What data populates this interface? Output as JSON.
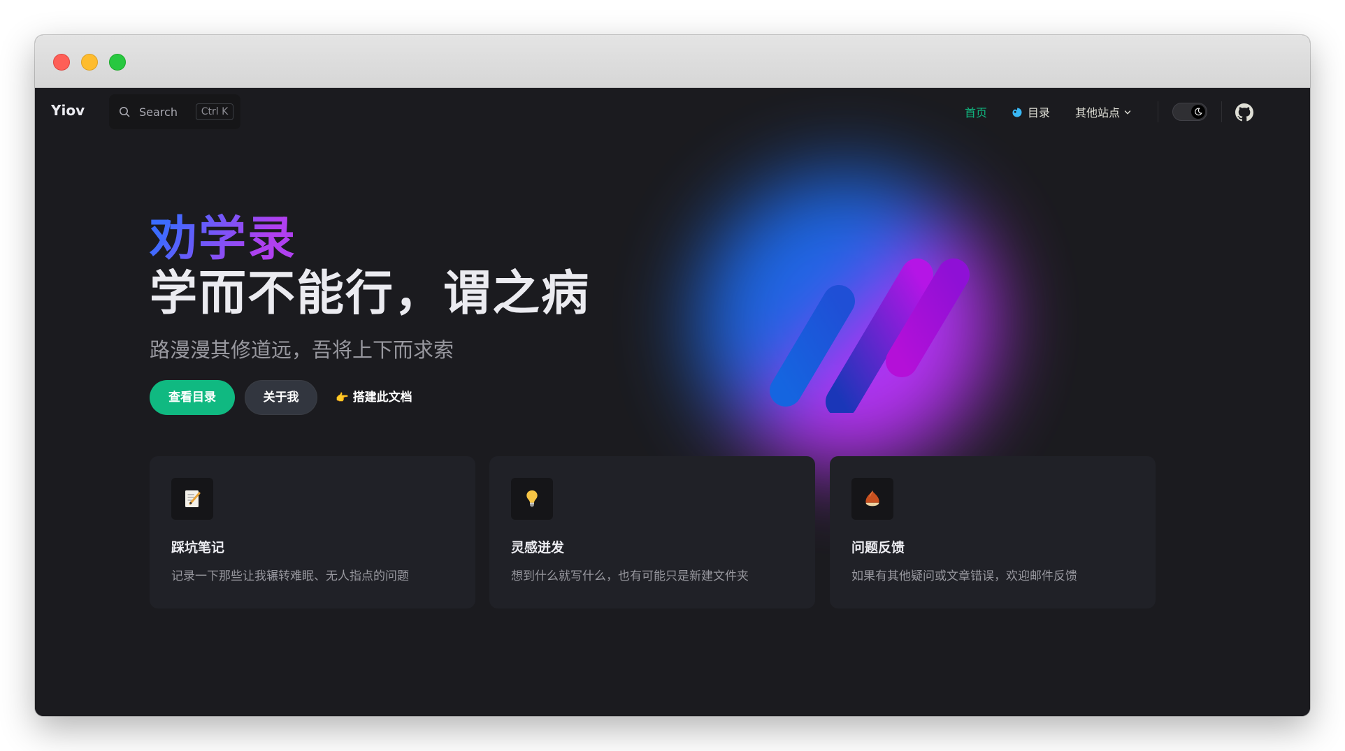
{
  "nav": {
    "logo": "Yiov",
    "search_label": "Search",
    "search_shortcut": "Ctrl K",
    "links": [
      {
        "label": "首页",
        "active": true
      },
      {
        "label": "目录",
        "icon": "blob-icon"
      },
      {
        "label": "其他站点",
        "icon": "chevron-down-icon"
      }
    ],
    "theme_toggle": "dark",
    "github_icon": "github-icon"
  },
  "hero": {
    "name": "劝学录",
    "text": "学而不能行，谓之病",
    "tagline": "路漫漫其修道远，吾将上下而求索",
    "actions": [
      {
        "label": "查看目录",
        "theme": "brand"
      },
      {
        "label": "关于我",
        "theme": "alt"
      },
      {
        "label": "搭建此文档",
        "icon": "pointing-hand-icon"
      }
    ]
  },
  "features": [
    {
      "icon": "memo-icon",
      "title": "踩坑笔记",
      "details": "记录一下那些让我辗转难眠、无人指点的问题"
    },
    {
      "icon": "lightbulb-icon",
      "title": "灵感迸发",
      "details": "想到什么就写什么，也有可能只是新建文件夹"
    },
    {
      "icon": "chestnut-icon",
      "title": "问题反馈",
      "details": "如果有其他疑问或文章错误，欢迎邮件反馈"
    }
  ],
  "colors": {
    "brand": "#10b981",
    "background": "#1b1b1f",
    "card": "#202127",
    "text": "#ebebf0",
    "muted": "#98989f",
    "gradient_blue": "#3b6cff",
    "gradient_purple": "#bd34fe"
  }
}
